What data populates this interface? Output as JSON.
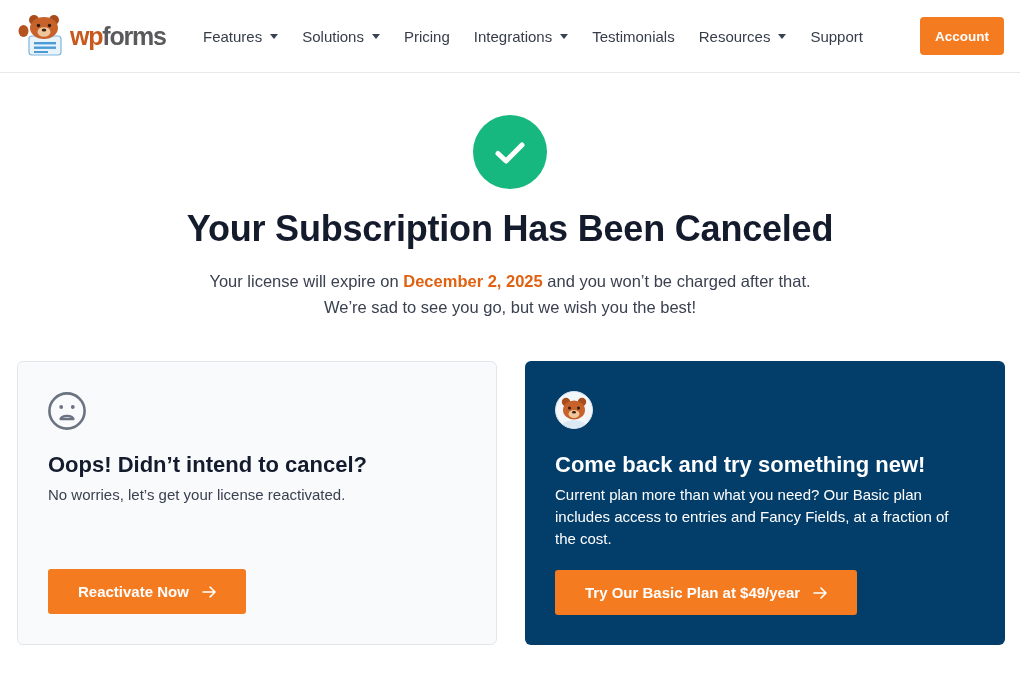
{
  "header": {
    "logo": {
      "wordmark": "**wp**forms"
    },
    "nav": [
      {
        "label": "Features",
        "has_menu": true
      },
      {
        "label": "Solutions",
        "has_menu": true
      },
      {
        "label": "Pricing",
        "has_menu": false
      },
      {
        "label": "Integrations",
        "has_menu": true
      },
      {
        "label": "Testimonials",
        "has_menu": false
      },
      {
        "label": "Resources",
        "has_menu": true
      },
      {
        "label": "Support",
        "has_menu": false
      }
    ],
    "account_button": "Account"
  },
  "hero": {
    "title": "Your Subscription Has Been Canceled",
    "message": "Your license will expire on **December 2, 2025** and you won’t be charged after that.",
    "message_2": "We’re sad to see you go, but we wish you the best!"
  },
  "cards": [
    {
      "kind": "reactivate",
      "title": "Oops! Didn’t intend to cancel?",
      "text": "No worries, let’s get your license reactivated.",
      "button": "Reactivate Now"
    },
    {
      "kind": "downgrade",
      "title": "Come back and try something new!",
      "text": "Current plan more than what you need? Our Basic plan includes access to entries and Fancy Fields, at a fraction of the cost.",
      "button": "Try Our Basic Plan at $49/year"
    }
  ]
}
